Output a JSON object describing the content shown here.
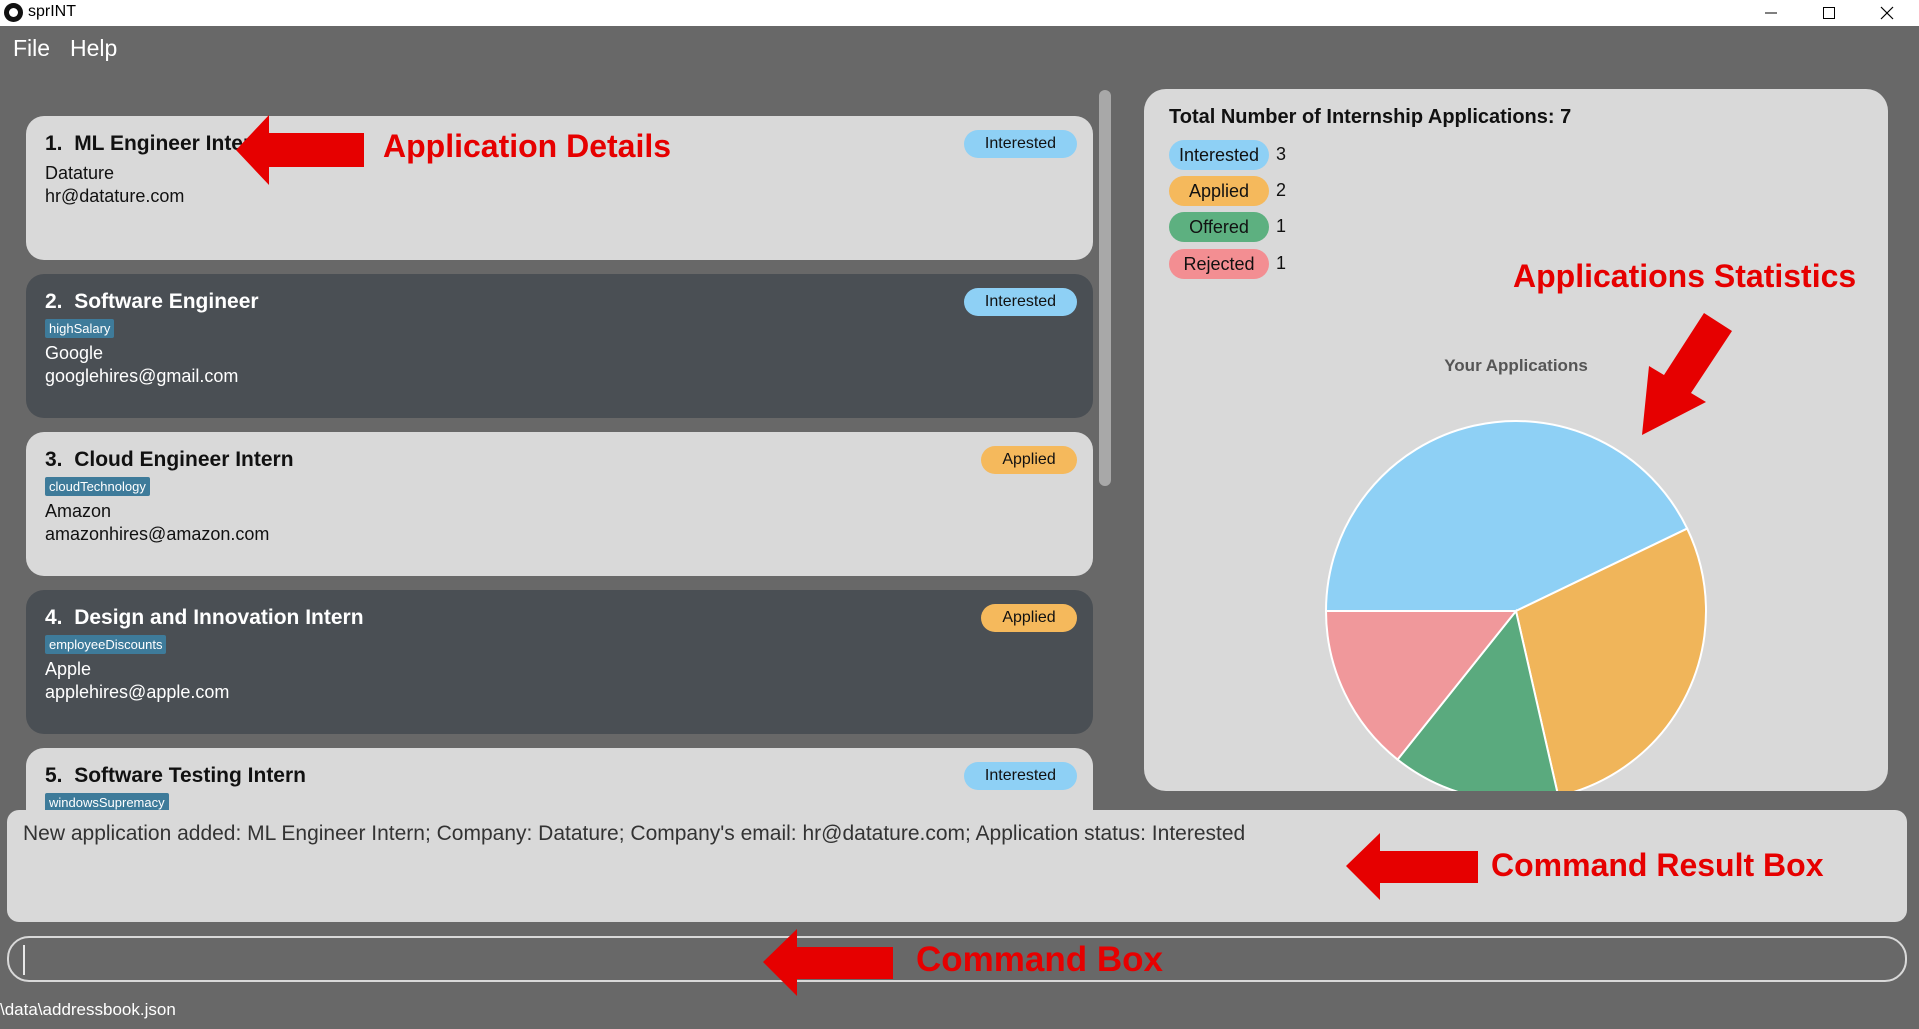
{
  "window": {
    "title": "sprINT"
  },
  "menu": [
    "File",
    "Help"
  ],
  "applications": [
    {
      "index": "1.",
      "role": "ML Engineer Intern",
      "tag": "",
      "company": "Datature",
      "email": "hr@datature.com",
      "status": "Interested"
    },
    {
      "index": "2.",
      "role": "Software Engineer",
      "tag": "highSalary",
      "company": "Google",
      "email": "googlehires@gmail.com",
      "status": "Interested"
    },
    {
      "index": "3.",
      "role": "Cloud Engineer Intern",
      "tag": "cloudTechnology",
      "company": "Amazon",
      "email": "amazonhires@amazon.com",
      "status": "Applied"
    },
    {
      "index": "4.",
      "role": "Design and Innovation Intern",
      "tag": "employeeDiscounts",
      "company": "Apple",
      "email": "applehires@apple.com",
      "status": "Applied"
    },
    {
      "index": "5.",
      "role": "Software Testing Intern",
      "tag": "windowsSupremacy",
      "company": "",
      "email": "",
      "status": "Interested"
    }
  ],
  "stats": {
    "title": "Total Number of Internship Applications: 7",
    "legend": [
      {
        "label": "Interested",
        "count": "3",
        "color": "#8ed0f5"
      },
      {
        "label": "Applied",
        "count": "2",
        "color": "#f5b95c"
      },
      {
        "label": "Offered",
        "count": "1",
        "color": "#5db080"
      },
      {
        "label": "Rejected",
        "count": "1",
        "color": "#f38e92"
      }
    ]
  },
  "chart_data": {
    "type": "pie",
    "title": "Your Applications",
    "categories": [
      "Interested",
      "Applied",
      "Offered",
      "Rejected"
    ],
    "values": [
      3,
      2,
      1,
      1
    ],
    "colors": [
      "#8ed0f5",
      "#f0b55a",
      "#5aaa7e",
      "#f0989b"
    ]
  },
  "result_box": {
    "text": "New application added: ML Engineer Intern; Company: Datature; Company's email: hr@datature.com; Application status: Interested"
  },
  "command_box": {
    "value": ""
  },
  "status_bar": {
    "path": "\\data\\addressbook.json"
  },
  "annotations": {
    "details": "Application Details",
    "statistics": "Applications Statistics",
    "result": "Command Result Box",
    "command": "Command Box",
    "color": "#e60000"
  }
}
